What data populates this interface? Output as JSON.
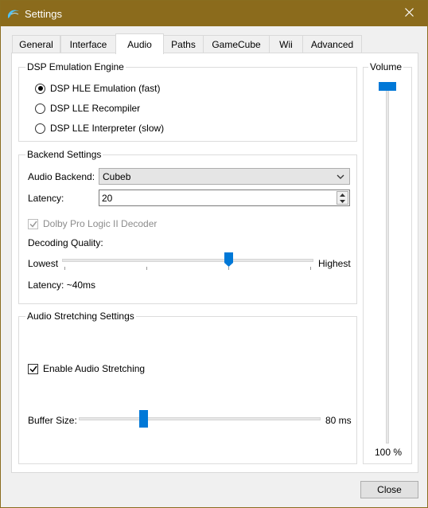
{
  "window": {
    "title": "Settings",
    "app_icon": "dolphin-icon",
    "close_icon": "close-icon"
  },
  "tabs": [
    {
      "label": "General",
      "active": false
    },
    {
      "label": "Interface",
      "active": false
    },
    {
      "label": "Audio",
      "active": true
    },
    {
      "label": "Paths",
      "active": false
    },
    {
      "label": "GameCube",
      "active": false
    },
    {
      "label": "Wii",
      "active": false
    },
    {
      "label": "Advanced",
      "active": false
    }
  ],
  "dsp": {
    "title": "DSP Emulation Engine",
    "options": [
      {
        "label": "DSP HLE Emulation (fast)",
        "checked": true
      },
      {
        "label": "DSP LLE Recompiler",
        "checked": false
      },
      {
        "label": "DSP LLE Interpreter (slow)",
        "checked": false
      }
    ]
  },
  "backend": {
    "title": "Backend Settings",
    "audio_backend_label": "Audio Backend:",
    "audio_backend_value": "Cubeb",
    "latency_label": "Latency:",
    "latency_value": "20",
    "dolby_label": "Dolby Pro Logic II Decoder",
    "dolby_checked": true,
    "dolby_enabled": false,
    "decoding_quality_label": "Decoding Quality:",
    "lowest_label": "Lowest",
    "highest_label": "Highest",
    "quality_level": 2,
    "quality_max": 3,
    "latency_readout": "Latency: ~40ms"
  },
  "stretching": {
    "title": "Audio Stretching Settings",
    "enable_label": "Enable Audio Stretching",
    "enable_checked": true,
    "buffer_label": "Buffer Size:",
    "buffer_value_text": "80 ms",
    "buffer_fraction": 0.26
  },
  "volume": {
    "title": "Volume",
    "value_text": "100 %",
    "fraction": 1.0
  },
  "footer": {
    "close_label": "Close"
  },
  "colors": {
    "accent": "#0078d7",
    "titlebar": "#8b6b1c"
  }
}
